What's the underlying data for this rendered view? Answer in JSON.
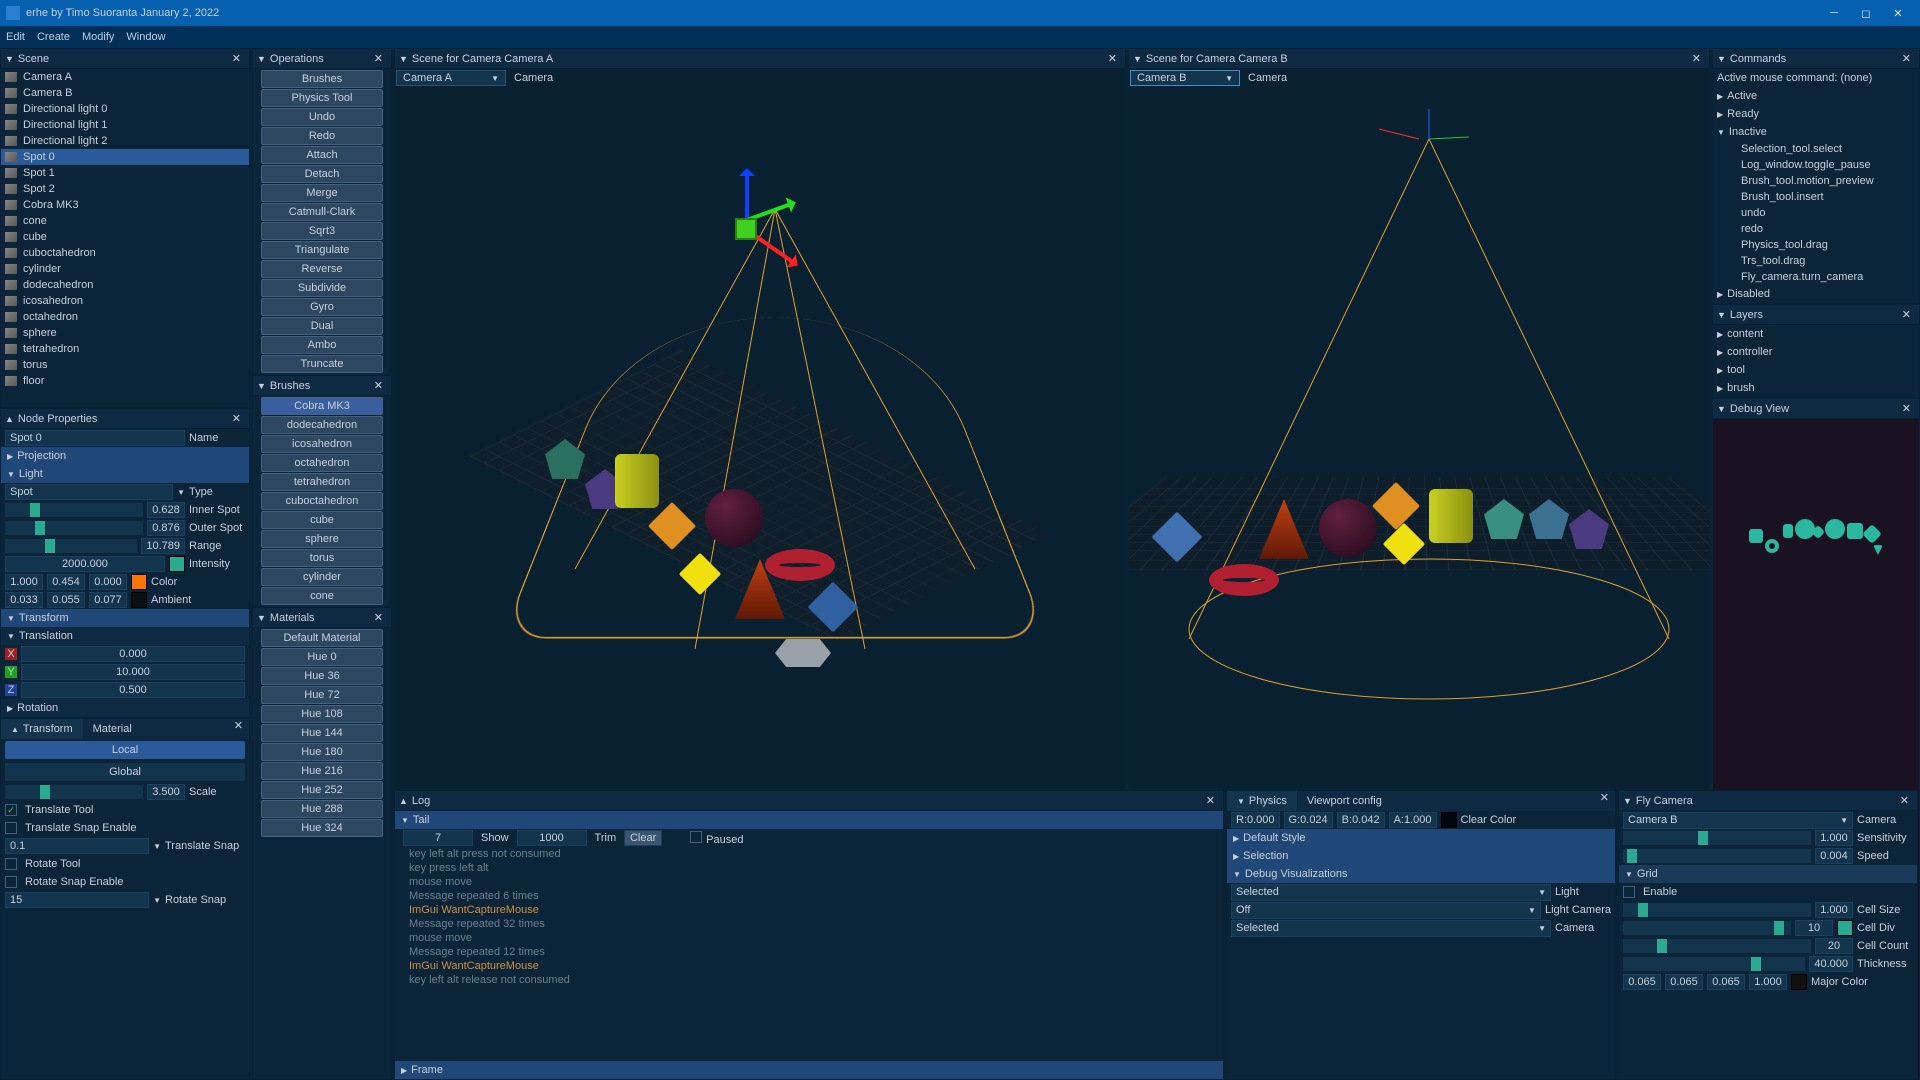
{
  "title": "erhe by Timo Suoranta January 2, 2022",
  "menu": [
    "Edit",
    "Create",
    "Modify",
    "Window"
  ],
  "scene": {
    "title": "Scene",
    "items": [
      "Camera A",
      "Camera B",
      "Directional light 0",
      "Directional light 1",
      "Directional light 2",
      "Spot 0",
      "Spot 1",
      "Spot 2",
      "Cobra MK3",
      "cone",
      "cube",
      "cuboctahedron",
      "cylinder",
      "dodecahedron",
      "icosahedron",
      "octahedron",
      "sphere",
      "tetrahedron",
      "torus",
      "floor"
    ],
    "selected": 5
  },
  "operations": {
    "title": "Operations",
    "items": [
      "Brushes",
      "Physics Tool",
      "Undo",
      "Redo",
      "Attach",
      "Detach",
      "Merge",
      "Catmull-Clark",
      "Sqrt3",
      "Triangulate",
      "Reverse",
      "Subdivide",
      "Gyro",
      "Dual",
      "Ambo",
      "Truncate"
    ]
  },
  "brushes": {
    "title": "Brushes",
    "items": [
      "Cobra MK3",
      "dodecahedron",
      "icosahedron",
      "octahedron",
      "tetrahedron",
      "cuboctahedron",
      "cube",
      "sphere",
      "torus",
      "cylinder",
      "cone"
    ],
    "selected": 0
  },
  "materials": {
    "title": "Materials",
    "items": [
      "Default Material",
      "Hue 0",
      "Hue 36",
      "Hue 72",
      "Hue 108",
      "Hue 144",
      "Hue 180",
      "Hue 216",
      "Hue 252",
      "Hue 288",
      "Hue 324"
    ]
  },
  "vpA": {
    "title": "Scene for Camera Camera A",
    "cam": "Camera A",
    "lbl": "Camera"
  },
  "vpB": {
    "title": "Scene for Camera Camera B",
    "cam": "Camera B",
    "lbl": "Camera"
  },
  "nodeprops": {
    "title": "Node Properties",
    "name_label": "Name",
    "node_name": "Spot 0",
    "projection": "Projection",
    "light": "Light",
    "spot_label": "Spot",
    "type_label": "Type",
    "inner": "0.628",
    "inner_lbl": "Inner Spot",
    "outer": "0.876",
    "outer_lbl": "Outer Spot",
    "range": "10.789",
    "range_lbl": "Range",
    "intensity": "2000.000",
    "intensity_lbl": "Intensity",
    "color": [
      "1.000",
      "0.454",
      "0.000"
    ],
    "color_lbl": "Color",
    "ambient": [
      "0.033",
      "0.055",
      "0.077"
    ],
    "ambient_lbl": "Ambient",
    "transform": "Transform",
    "translation": "Translation",
    "tx": "0.000",
    "ty": "10.000",
    "tz": "0.500",
    "rotation": "Rotation"
  },
  "transform_panel": {
    "tabs": [
      "Transform",
      "Material"
    ],
    "local": "Local",
    "global": "Global",
    "scale": "3.500",
    "scale_lbl": "Scale",
    "translate_tool": "Translate Tool",
    "translate_snap_enable": "Translate Snap Enable",
    "translate_snap_val": "0.1",
    "translate_snap_lbl": "Translate Snap",
    "rotate_tool": "Rotate Tool",
    "rotate_snap_enable": "Rotate Snap Enable",
    "rotate_snap_val": "15",
    "rotate_snap_lbl": "Rotate Snap"
  },
  "log": {
    "title": "Log",
    "tail_hdr": "Tail",
    "tail_count": "7",
    "show": "Show",
    "show_val": "1000",
    "trim": "Trim",
    "clear": "Clear",
    "paused": "Paused",
    "lines": [
      {
        "t": "key left alt press not consumed",
        "b": 0
      },
      {
        "t": "key press left alt",
        "b": 0
      },
      {
        "t": "mouse move",
        "b": 0
      },
      {
        "t": "Message repeated 6 times",
        "b": 0
      },
      {
        "t": "ImGui WantCaptureMouse",
        "b": 1
      },
      {
        "t": "Message repeated 32 times",
        "b": 0
      },
      {
        "t": "mouse move",
        "b": 0
      },
      {
        "t": "Message repeated 12 times",
        "b": 0
      },
      {
        "t": "ImGui WantCaptureMouse",
        "b": 1
      },
      {
        "t": "key left alt release not consumed",
        "b": 0
      }
    ],
    "frame": "Frame"
  },
  "physics": {
    "tabs": [
      "Physics",
      "Viewport config"
    ],
    "r": "R:0.000",
    "g": "G:0.024",
    "b": "B:0.042",
    "a": "A:1.000",
    "clear": "Clear Color",
    "default_style": "Default Style",
    "selection": "Selection",
    "debug_viz": "Debug Visualizations",
    "rows": [
      {
        "v": "Selected",
        "l": "Light"
      },
      {
        "v": "Off",
        "l": "Light Camera"
      },
      {
        "v": "Selected",
        "l": "Camera"
      }
    ]
  },
  "commands": {
    "title": "Commands",
    "mouse": "Active mouse command: (none)",
    "active": "Active",
    "ready": "Ready",
    "inactive": "Inactive",
    "inactive_items": [
      "Selection_tool.select",
      "Log_window.toggle_pause",
      "Brush_tool.motion_preview",
      "Brush_tool.insert",
      "undo",
      "redo",
      "Physics_tool.drag",
      "Trs_tool.drag",
      "Fly_camera.turn_camera"
    ],
    "disabled": "Disabled"
  },
  "layers": {
    "title": "Layers",
    "items": [
      "content",
      "controller",
      "tool",
      "brush"
    ]
  },
  "debugview": {
    "title": "Debug View"
  },
  "flycam": {
    "title": "Fly Camera",
    "cam": "Camera B",
    "cam_lbl": "Camera",
    "sens": "1.000",
    "sens_lbl": "Sensitivity",
    "speed": "0.004",
    "speed_lbl": "Speed",
    "grid": "Grid",
    "enable": "Enable",
    "cellsize": "1.000",
    "cellsize_lbl": "Cell Size",
    "celldiv": "10",
    "celldiv_lbl": "Cell Div",
    "cellcount": "20",
    "cellcount_lbl": "Cell Count",
    "thick": "40.000",
    "thick_lbl": "Thickness",
    "major": [
      "0.065",
      "0.065",
      "0.065",
      "1.000"
    ],
    "major_lbl": "Major Color"
  }
}
